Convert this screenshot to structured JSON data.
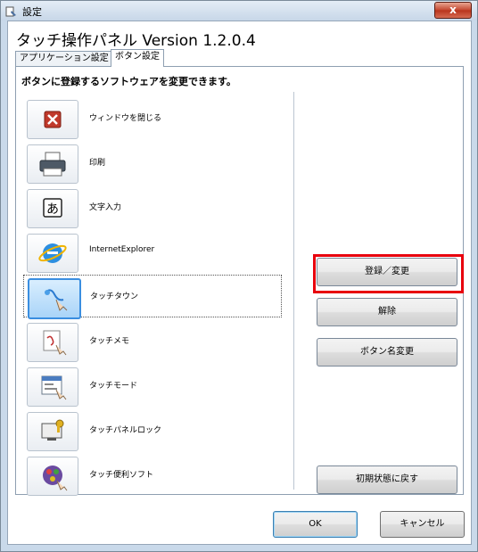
{
  "window": {
    "title": "設定",
    "close_label": "x"
  },
  "app_heading": "タッチ操作パネル  Version 1.2.0.4",
  "tabs": [
    {
      "label": "アプリケーション設定",
      "active": false
    },
    {
      "label": "ボタン設定",
      "active": true
    }
  ],
  "panel_description": "ボタンに登録するソフトウェアを変更できます。",
  "buttons": [
    {
      "label": "ウィンドウを閉じる",
      "icon": "close-window-icon"
    },
    {
      "label": "印刷",
      "icon": "printer-icon"
    },
    {
      "label": "文字入力",
      "icon": "text-input-icon",
      "glyph": "あ"
    },
    {
      "label": "InternetExplorer",
      "icon": "internet-explorer-icon"
    },
    {
      "label": "タッチタウン",
      "icon": "touch-town-icon",
      "selected": true
    },
    {
      "label": "タッチメモ",
      "icon": "touch-memo-icon"
    },
    {
      "label": "タッチモード",
      "icon": "touch-mode-icon"
    },
    {
      "label": "タッチパネルロック",
      "icon": "touch-panel-lock-icon"
    },
    {
      "label": "タッチ便利ソフト",
      "icon": "touch-utility-icon"
    }
  ],
  "actions": {
    "register": "登録／変更",
    "release": "解除",
    "rename": "ボタン名変更",
    "reset": "初期状態に戻す"
  },
  "dialog": {
    "ok": "OK",
    "cancel": "キャンセル"
  },
  "colors": {
    "highlight": "#e8000d",
    "selection": "#3a8ee0"
  }
}
